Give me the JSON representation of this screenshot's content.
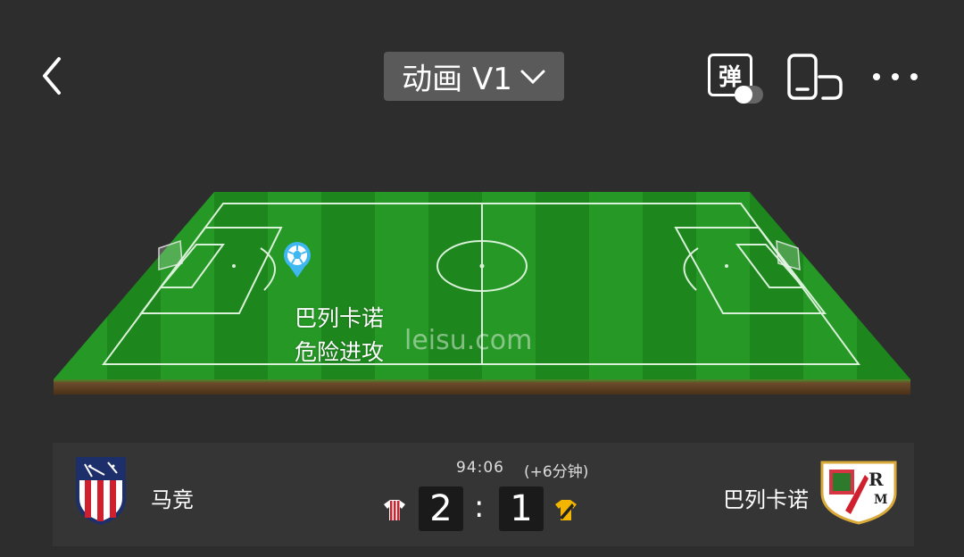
{
  "header": {
    "back_icon": "chevron-left-icon",
    "animation_selector_label": "动画 V1",
    "danmu_label": "弹",
    "orientation_icon": "rotate-device-icon",
    "more_icon": "more-dots-icon"
  },
  "pitch": {
    "watermark": "leisu.com",
    "event_team": "巴列卡诺",
    "event_text": "危险进攻",
    "colors": {
      "grass_dark": "#1f8a1f",
      "grass_light": "#2ea02e",
      "soil": "#6b4a2a"
    }
  },
  "scoreboard": {
    "home_team": "马竞",
    "away_team": "巴列卡诺",
    "clock": "94:06",
    "added_time": "(+6分钟)",
    "home_score": "2",
    "away_score": "1",
    "separator": ":"
  }
}
